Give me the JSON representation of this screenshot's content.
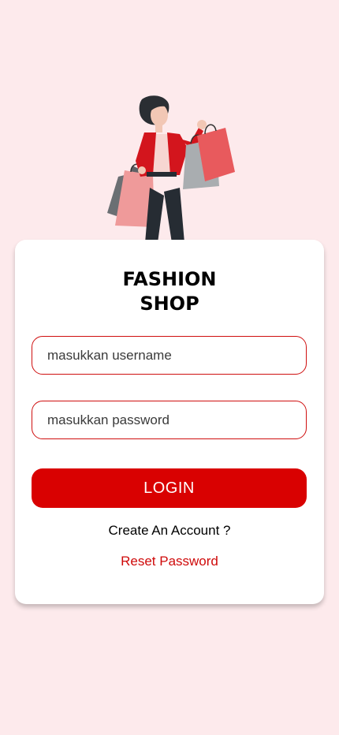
{
  "header": {
    "illustration_icon": "shopping-woman-illustration"
  },
  "card": {
    "title_line1": "FASHION",
    "title_line2": "SHOP",
    "username_placeholder": "masukkan username",
    "password_placeholder": "masukkan password",
    "login_label": "LOGIN",
    "create_account_label": "Create An Account ?",
    "reset_password_label": "Reset Password"
  },
  "colors": {
    "background": "#fdeaec",
    "accent": "#d90101",
    "card": "#ffffff"
  }
}
